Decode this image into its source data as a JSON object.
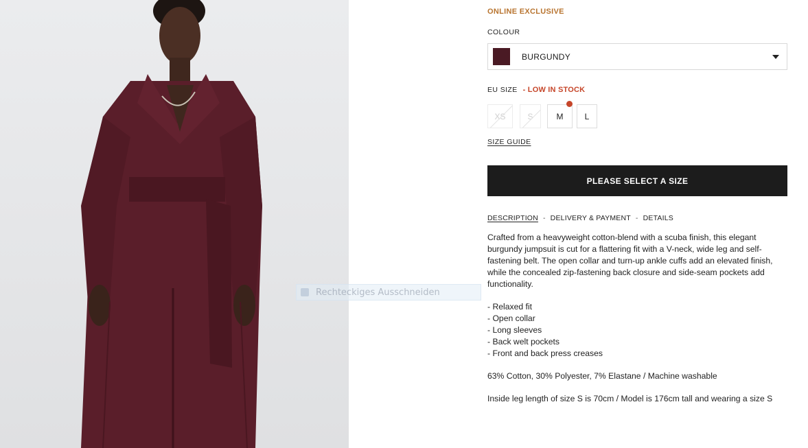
{
  "colors": {
    "accent_exclusive": "#b8742f",
    "low_stock": "#c6462a",
    "swatch": "#4a1a24",
    "cta_bg": "#1c1c1c",
    "garment": "#5a1e2a"
  },
  "product": {
    "badge": "ONLINE EXCLUSIVE",
    "colour_label": "COLOUR",
    "colour_value": "BURGUNDY",
    "size_label": "EU SIZE",
    "stock_status": "- LOW IN STOCK",
    "sizes": [
      {
        "label": "XS",
        "available": false
      },
      {
        "label": "S",
        "available": false
      },
      {
        "label": "M",
        "available": true,
        "low_stock": true
      },
      {
        "label": "L",
        "available": true
      }
    ],
    "size_guide": "SIZE GUIDE",
    "cta": "PLEASE SELECT A SIZE"
  },
  "tabs": {
    "description": "DESCRIPTION",
    "delivery": "DELIVERY & PAYMENT",
    "details": "DETAILS",
    "separator": "-"
  },
  "description": {
    "intro": "Crafted from a heavyweight cotton-blend with a scuba finish, this elegant burgundy jumpsuit is cut for a flattering fit with a V-neck, wide leg and self-fastening belt. The open collar and turn-up ankle cuffs add an elevated finish, while the concealed zip-fastening back closure and side-seam pockets add functionality.",
    "features": [
      "- Relaxed fit",
      "- Open collar",
      "- Long sleeves",
      "- Back welt pockets",
      "- Front and back press creases"
    ],
    "material": "63% Cotton, 30% Polyester, 7% Elastane / Machine washable",
    "fit_note": "Inside leg length of size S is 70cm / Model is 176cm tall and wearing a size S"
  },
  "overlay": {
    "snip_label": "Rechteckiges Ausschneiden",
    "snip_icon": "snip-icon"
  }
}
